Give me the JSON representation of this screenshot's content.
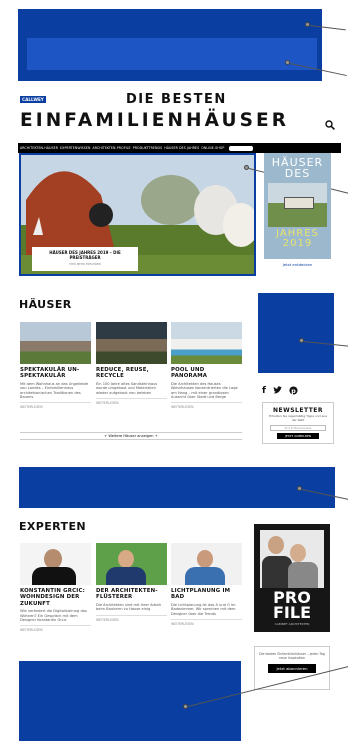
{
  "colors": {
    "ad_blue": "#0a3ea1",
    "nav_bg": "#000000"
  },
  "brand": {
    "logo": "CALLWEY",
    "title_line1": "DIE BESTEN",
    "title_line2": "EINFAMILIENHÄUSER"
  },
  "nav": {
    "items": [
      "ARCHITEKTEN-HÄUSER",
      "EXPERTENWISSEN",
      "ARCHITEKTEN-PROFILE",
      "PRODUKTTRENDS",
      "HÄUSER DES JAHRES",
      "ONLINE-SHOP"
    ]
  },
  "hero": {
    "caption_title": "HÄUSER DES JAHRES 2019 – DIE PREISTRÄGER",
    "caption_link": "HIER MEHR ERFAHREN"
  },
  "book": {
    "line1": "HÄUSER",
    "line2": "DES",
    "line3": "JAHRES",
    "year": "2019",
    "cta": "Jetzt entdecken"
  },
  "houses": {
    "heading": "HÄUSER",
    "cards": [
      {
        "title": "SPEKTAKULÄR UN-SPEKTAKULÄR",
        "text": "Mit dem Wohnhaus an das Ungeliebte von Landes – Einfamilienhaus architektonischen Traditionen des Bauens",
        "more": "WEITERLESEN"
      },
      {
        "title": "REDUCE, REUSE, RECYCLE",
        "text": "Ein 100 Jahre altes Sandsteinhaus wurde umgebaut und Materialien wieder aufgebaut neu beleben",
        "more": "WEITERLESEN"
      },
      {
        "title": "POOL UND PANORAMA",
        "text": "Die Architekten des Hauses Wohnhauses konzentrierten die Lage am Hang – mit einer grandiosen Aussicht über Stadt und Berge",
        "more": "WEITERLESEN"
      }
    ],
    "all_link": "Weitere Häuser anzeigen"
  },
  "social": {
    "icons": [
      "f",
      "twitter",
      "pinterest"
    ]
  },
  "newsletter": {
    "title": "NEWSLETTER",
    "text": "Erhalten Sie regelmäßig Tipps und aus der Welt",
    "placeholder": "Ihre E-Mail-Adresse",
    "button": "JETZT ANMELDEN"
  },
  "experts": {
    "heading": "EXPERTEN",
    "cards": [
      {
        "title": "KONSTANTIN GRCIC: WOHNDESIGN DER ZUKUNFT",
        "text": "Wie verändert die Digitalisierung das Wohnen? Ein Gespräch mit dem Designer Konstantin Grcic",
        "more": "WEITERLESEN"
      },
      {
        "title": "DER ARCHITEKTEN-FLÜSTERER",
        "text": "Die Architekten sind mit ihrer Arbeit beim Bauherrn zu Hause einig",
        "more": "WEITERLESEN"
      },
      {
        "title": "LICHTPLANUNG IM BAD",
        "text": "Die Lichtplanung ist das A und O im Badezimmer. Wir sprechen mit dem Designer über die Trends",
        "more": "WEITERLESEN"
      }
    ]
  },
  "profile": {
    "big": "PRO FILE",
    "sub": "CABINET ARCHITEKTEN"
  },
  "subscribe": {
    "text": "Die besten Einfamilienhäuser – jeden Tag neue Inspiration",
    "button": "Jetzt abonnieren"
  }
}
